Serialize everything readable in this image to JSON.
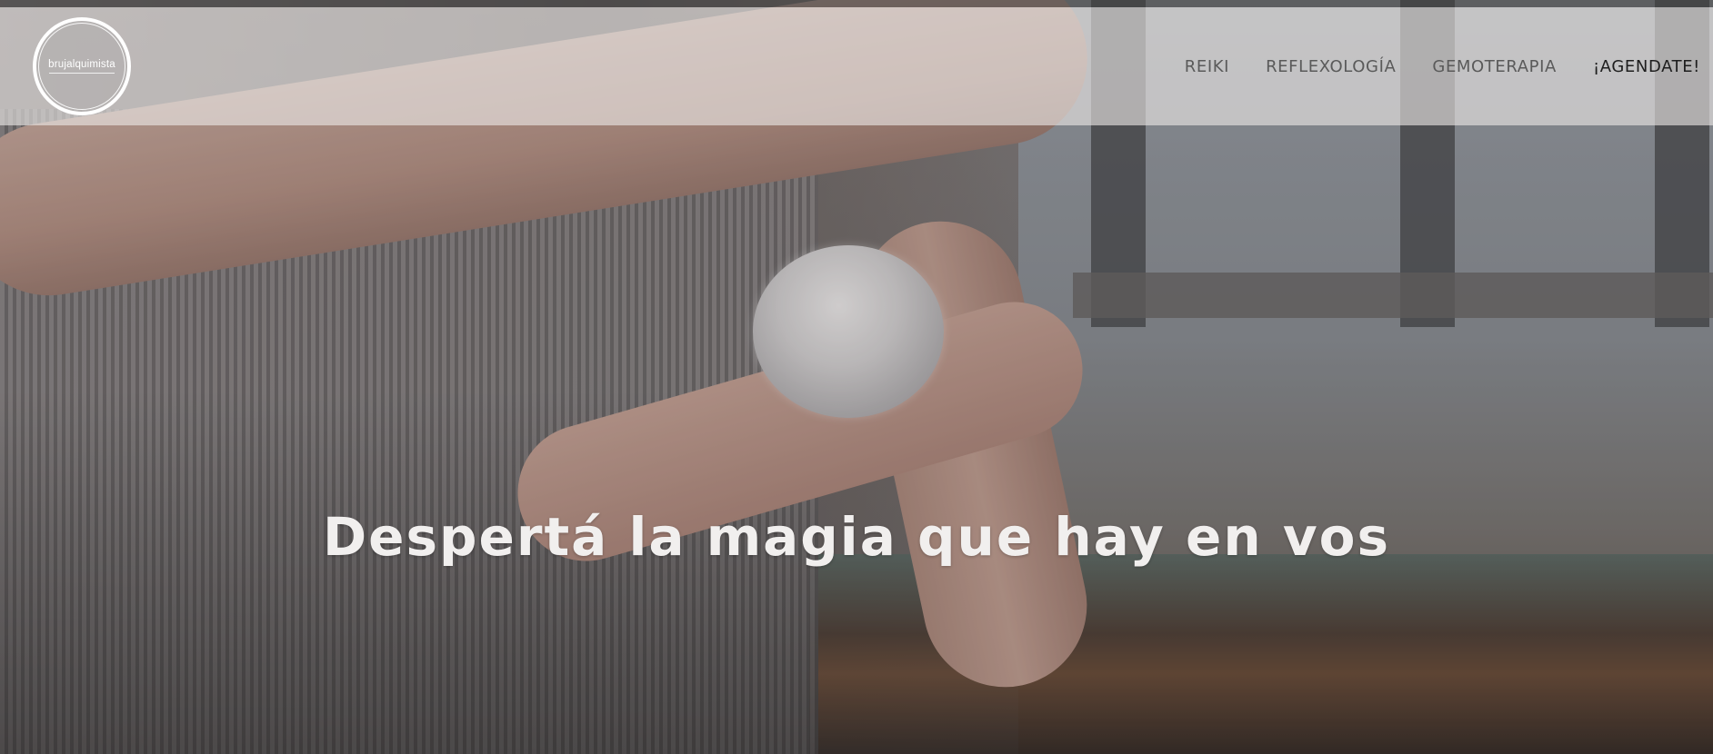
{
  "logo": {
    "text": "brujalquimista",
    "icon": "circle-logo"
  },
  "nav": {
    "items": [
      {
        "label": "REIKI"
      },
      {
        "label": "REFLEXOLOGÍA"
      },
      {
        "label": "GEMOTERAPIA"
      },
      {
        "label": "¡AGENDATE!"
      }
    ]
  },
  "hero": {
    "headline": "Despertá la magia que hay en vos"
  },
  "colors": {
    "header_bg": "#ebe8e6",
    "nav_text": "#5a5a5a",
    "nav_active": "#1e1e1e",
    "headline": "#f1efee"
  }
}
